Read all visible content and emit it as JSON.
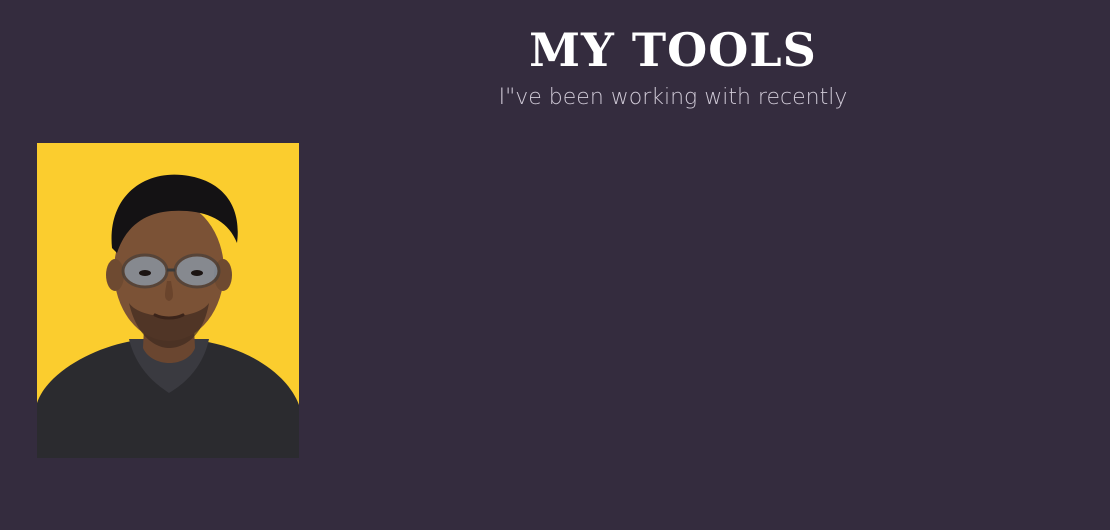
{
  "section": {
    "title": "MY TOOLS",
    "subtitle": "I\"ve been working with recently"
  },
  "portrait": {
    "alt": "Portrait photo"
  },
  "colors": {
    "background": "#342c3e",
    "title": "#ffffff",
    "subtitle": "#cfc9d6",
    "portrait_backdrop": "#fbcd2e"
  }
}
